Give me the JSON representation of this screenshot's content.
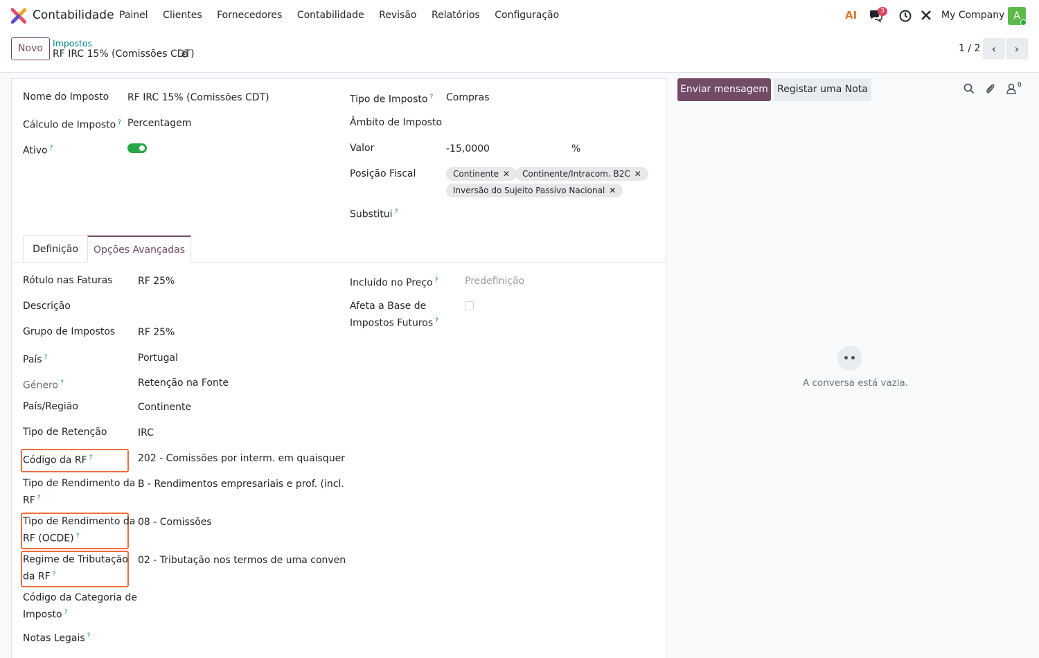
{
  "app": {
    "name": "Contabilidade"
  },
  "menu": [
    "Painel",
    "Clientes",
    "Fornecedores",
    "Contabilidade",
    "Revisão",
    "Relatórios",
    "Configuração"
  ],
  "systray": {
    "ai_label": "AI",
    "messages_badge": "3",
    "company": "My Company",
    "avatar_letter": "A"
  },
  "control": {
    "new_label": "Novo",
    "breadcrumb": "Impostos",
    "record_title": "RF IRC 15% (Comissões CDT)",
    "pager": "1 / 2"
  },
  "form": {
    "left": [
      {
        "label": "Nome do Imposto",
        "value": "RF IRC 15% (Comissões CDT)",
        "help": ""
      },
      {
        "label": "Cálculo de Imposto",
        "value": "Percentagem",
        "help": "?"
      },
      {
        "label": "Ativo",
        "value": "",
        "help": "?"
      }
    ],
    "right": {
      "tipo_label": "Tipo de Imposto",
      "tipo_value": "Compras",
      "help": "?",
      "ambito_label": "Âmbito de Imposto",
      "valor_label": "Valor",
      "valor_value": "-15,0000",
      "valor_unit": "%",
      "posicao_label": "Posição Fiscal",
      "tags": [
        "Continente",
        "Continente/Intracom. B2C",
        "Inversão do Sujeito Passivo Nacional"
      ],
      "substitui_label": "Substitui"
    },
    "active": true
  },
  "tabs": [
    "Definição",
    "Opções Avançadas"
  ],
  "advanced": {
    "left": [
      {
        "label": "Rótulo nas Faturas",
        "value": "RF 25%"
      },
      {
        "label": "Descrição",
        "value": ""
      },
      {
        "label": "Grupo de Impostos",
        "value": "RF 25%"
      },
      {
        "label": "País",
        "value": "Portugal",
        "help": "?"
      },
      {
        "label": "Género",
        "value": "Retenção na Fonte",
        "help": "?"
      },
      {
        "label": "País/Região",
        "value": "Continente"
      },
      {
        "label": "Tipo de Retenção",
        "value": "IRC"
      },
      {
        "label": "Código da RF",
        "value": "202 - Comissões por interm. em quaisquer",
        "help": "?"
      },
      {
        "label_1": "Tipo de Rendimento da",
        "label_2": "RF",
        "value": "B - Rendimentos empresariais e prof. (incl.",
        "help": "?"
      },
      {
        "label_1": "Tipo de Rendimento da",
        "label_2": "RF (OCDE)",
        "value": "08 - Comissões",
        "help": "?"
      },
      {
        "label_1": "Regime de Tributação",
        "label_2": "da RF",
        "value": "02 - Tributação nos termos de uma conven",
        "help": "?"
      },
      {
        "label_1": "Código da Categoria de",
        "label_2": "Imposto",
        "value": "",
        "help": "?"
      },
      {
        "label": "Notas Legais",
        "value": "",
        "help": "?"
      }
    ],
    "right": {
      "incluido_label": "Incluído no Preço",
      "incluido_value": "Predefinição",
      "help": "?",
      "afeta_label_1": "Afeta a Base de",
      "afeta_label_2": "Impostos Futuros"
    }
  },
  "chatter": {
    "send_label": "Enviar mensagem",
    "note_label": "Registar uma Nota",
    "followers": "0",
    "empty_text": "A conversa está vazia."
  },
  "colors": {
    "brand": "#714b67",
    "link": "#017e84",
    "highlight": "#f26b3a",
    "toggle": "#28a745"
  }
}
